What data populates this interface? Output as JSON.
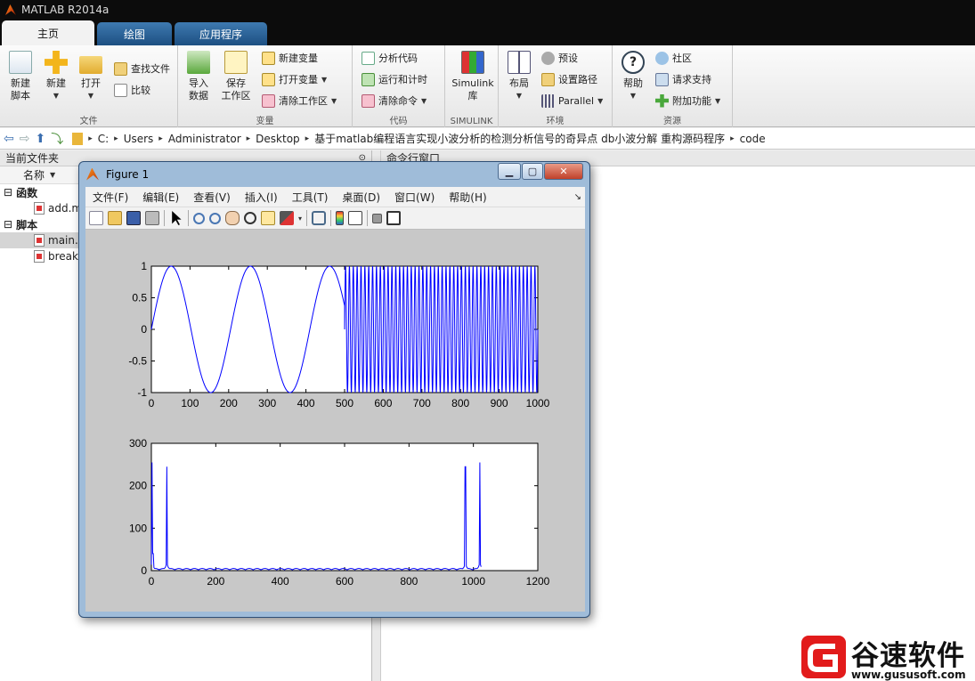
{
  "app": {
    "title": "MATLAB R2014a"
  },
  "tabs": [
    {
      "label": "主页"
    },
    {
      "label": "绘图"
    },
    {
      "label": "应用程序"
    }
  ],
  "ribbon": {
    "file_group": {
      "label": "文件",
      "new_script": "新建\n脚本",
      "new": "新建",
      "open": "打开",
      "find_files": "查找文件",
      "compare": "比较"
    },
    "variable_group": {
      "label": "变量",
      "import_data": "导入\n数据",
      "save_workspace": "保存\n工作区",
      "new_variable": "新建变量",
      "open_variable": "打开变量",
      "clear_workspace": "清除工作区"
    },
    "code_group": {
      "label": "代码",
      "analyze_code": "分析代码",
      "run_and_time": "运行和计时",
      "clear_commands": "清除命令"
    },
    "simulink_group": {
      "label": "SIMULINK",
      "simulink_library": "Simulink\n库"
    },
    "environment_group": {
      "label": "环境",
      "layout": "布局",
      "preferences": "预设",
      "set_path": "设置路径",
      "parallel": "Parallel"
    },
    "resources_group": {
      "label": "资源",
      "help": "帮助",
      "community": "社区",
      "request_support": "请求支持",
      "add_ons": "附加功能"
    }
  },
  "address": {
    "segments": [
      "C:",
      "Users",
      "Administrator",
      "Desktop",
      "基于matlab编程语言实现小波分析的检测分析信号的奇异点 db小波分解 重构源码程序",
      "code"
    ]
  },
  "current_folder": {
    "title": "当前文件夹",
    "column_name": "名称",
    "groups": [
      {
        "label": "函数",
        "files": [
          "add.m"
        ]
      },
      {
        "label": "脚本",
        "files": [
          "main.m",
          "break"
        ]
      }
    ]
  },
  "command_window": {
    "title": "命令行窗口"
  },
  "figure": {
    "title": "Figure 1",
    "menu": [
      "文件(F)",
      "编辑(E)",
      "查看(V)",
      "插入(I)",
      "工具(T)",
      "桌面(D)",
      "窗口(W)",
      "帮助(H)"
    ],
    "toolbar_icons": [
      "new-figure-icon",
      "open-file-icon",
      "save-icon",
      "print-icon",
      "pointer-icon",
      "zoom-in-icon",
      "zoom-out-icon",
      "pan-icon",
      "rotate-icon",
      "data-cursor-icon",
      "brush-icon",
      "link-icon",
      "colorbar-icon",
      "legend-icon",
      "hide-plot-tools-icon",
      "show-plot-tools-icon"
    ]
  },
  "chart_data": [
    {
      "type": "line",
      "description_source": "Signal: sine of period ~200 for x<500 (starts at 0), then high-frequency sine after x=500",
      "xlim": [
        0,
        1000
      ],
      "ylim": [
        -1,
        1
      ],
      "xticks": [
        0,
        100,
        200,
        300,
        400,
        500,
        600,
        700,
        800,
        900,
        1000
      ],
      "yticks": [
        -1,
        -0.5,
        0,
        0.5,
        1
      ],
      "xtick_labels": [
        "0",
        "100",
        "200",
        "300",
        "400",
        "500",
        "600",
        "700",
        "800",
        "900",
        "1000"
      ],
      "ytick_labels": [
        "-1",
        "-0.5",
        "0",
        "0.5",
        "1"
      ],
      "series": [
        {
          "color": "#0000ff",
          "segments": [
            {
              "x_start": 0,
              "x_end": 500,
              "period": 205
            },
            {
              "x_start": 500,
              "x_end": 1000,
              "period": 10
            }
          ]
        }
      ],
      "xlabel": "",
      "ylabel": "",
      "title": ""
    },
    {
      "type": "line",
      "xlim": [
        0,
        1200
      ],
      "ylim": [
        0,
        300
      ],
      "xticks": [
        0,
        200,
        400,
        600,
        800,
        1000,
        1200
      ],
      "yticks": [
        0,
        100,
        200,
        300
      ],
      "xtick_labels": [
        "0",
        "200",
        "400",
        "600",
        "800",
        "1000",
        "1200"
      ],
      "ytick_labels": [
        "0",
        "100",
        "200",
        "300"
      ],
      "series": [
        {
          "color": "#0000ff",
          "peaks": [
            {
              "x": 2,
              "y": 255
            },
            {
              "x": 5,
              "y": 40
            },
            {
              "x": 48,
              "y": 245
            },
            {
              "x": 975,
              "y": 245
            },
            {
              "x": 1020,
              "y": 255
            }
          ]
        }
      ],
      "xlabel": "",
      "ylabel": "",
      "title": ""
    }
  ],
  "watermark": {
    "title": "谷速软件",
    "url": "www.gususoft.com",
    "brand_color": "#e21b1b"
  }
}
